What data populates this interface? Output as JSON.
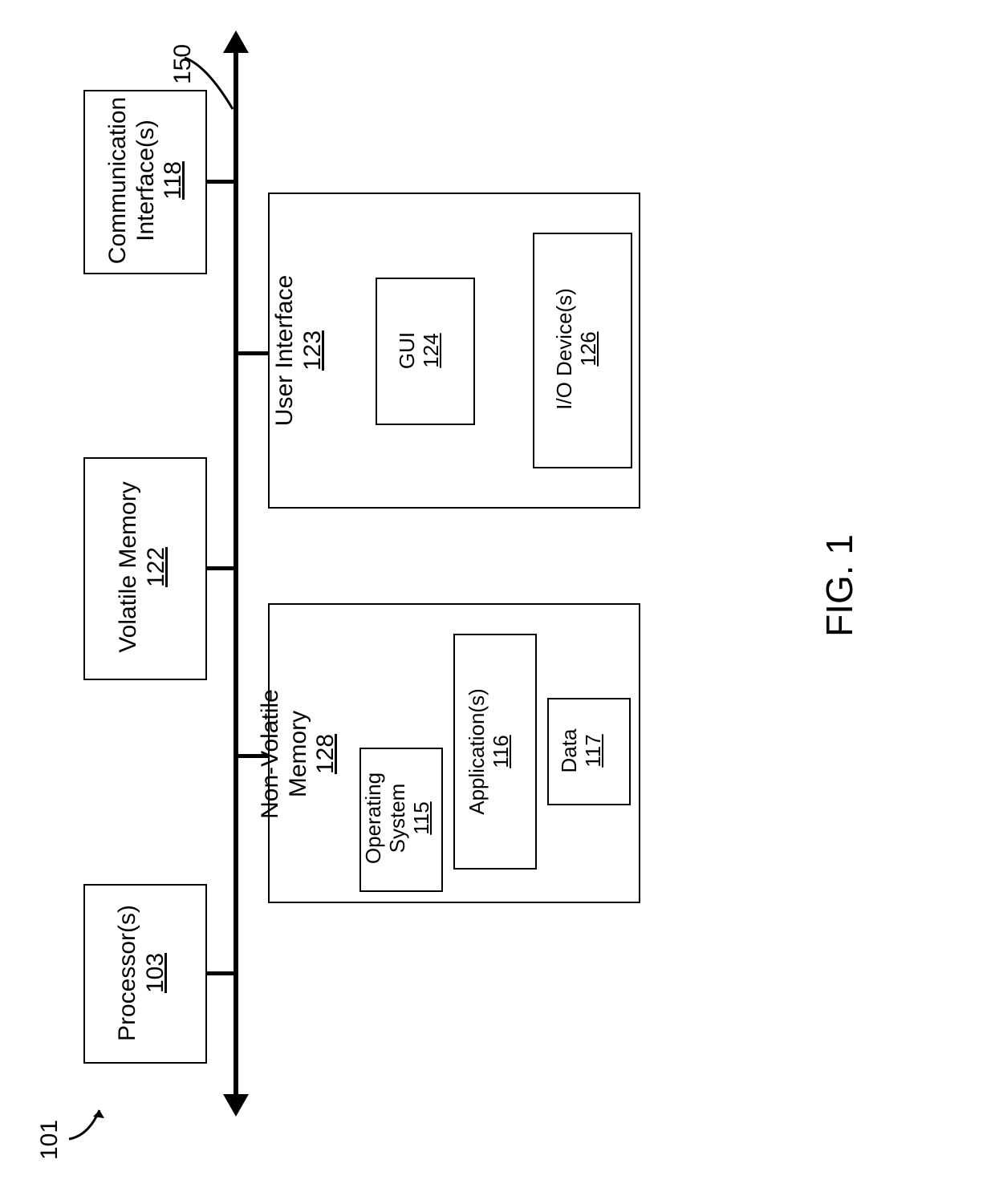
{
  "figure_ref": "101",
  "figure_caption": "FIG. 1",
  "bus_label": "150",
  "blocks": {
    "processor": {
      "label": "Processor(s)",
      "ref": "103"
    },
    "volatile": {
      "label": "Volatile Memory",
      "ref": "122"
    },
    "comm": {
      "label": "Communication Interface(s)",
      "ref": "118"
    },
    "nvram": {
      "label": "Non-Volatile Memory",
      "ref": "128"
    },
    "os": {
      "label": "Operating System",
      "ref": "115"
    },
    "apps": {
      "label": "Application(s)",
      "ref": "116"
    },
    "data": {
      "label": "Data",
      "ref": "117"
    },
    "ui": {
      "label": "User Interface",
      "ref": "123"
    },
    "gui": {
      "label": "GUI",
      "ref": "124"
    },
    "io": {
      "label": "I/O Device(s)",
      "ref": "126"
    }
  }
}
